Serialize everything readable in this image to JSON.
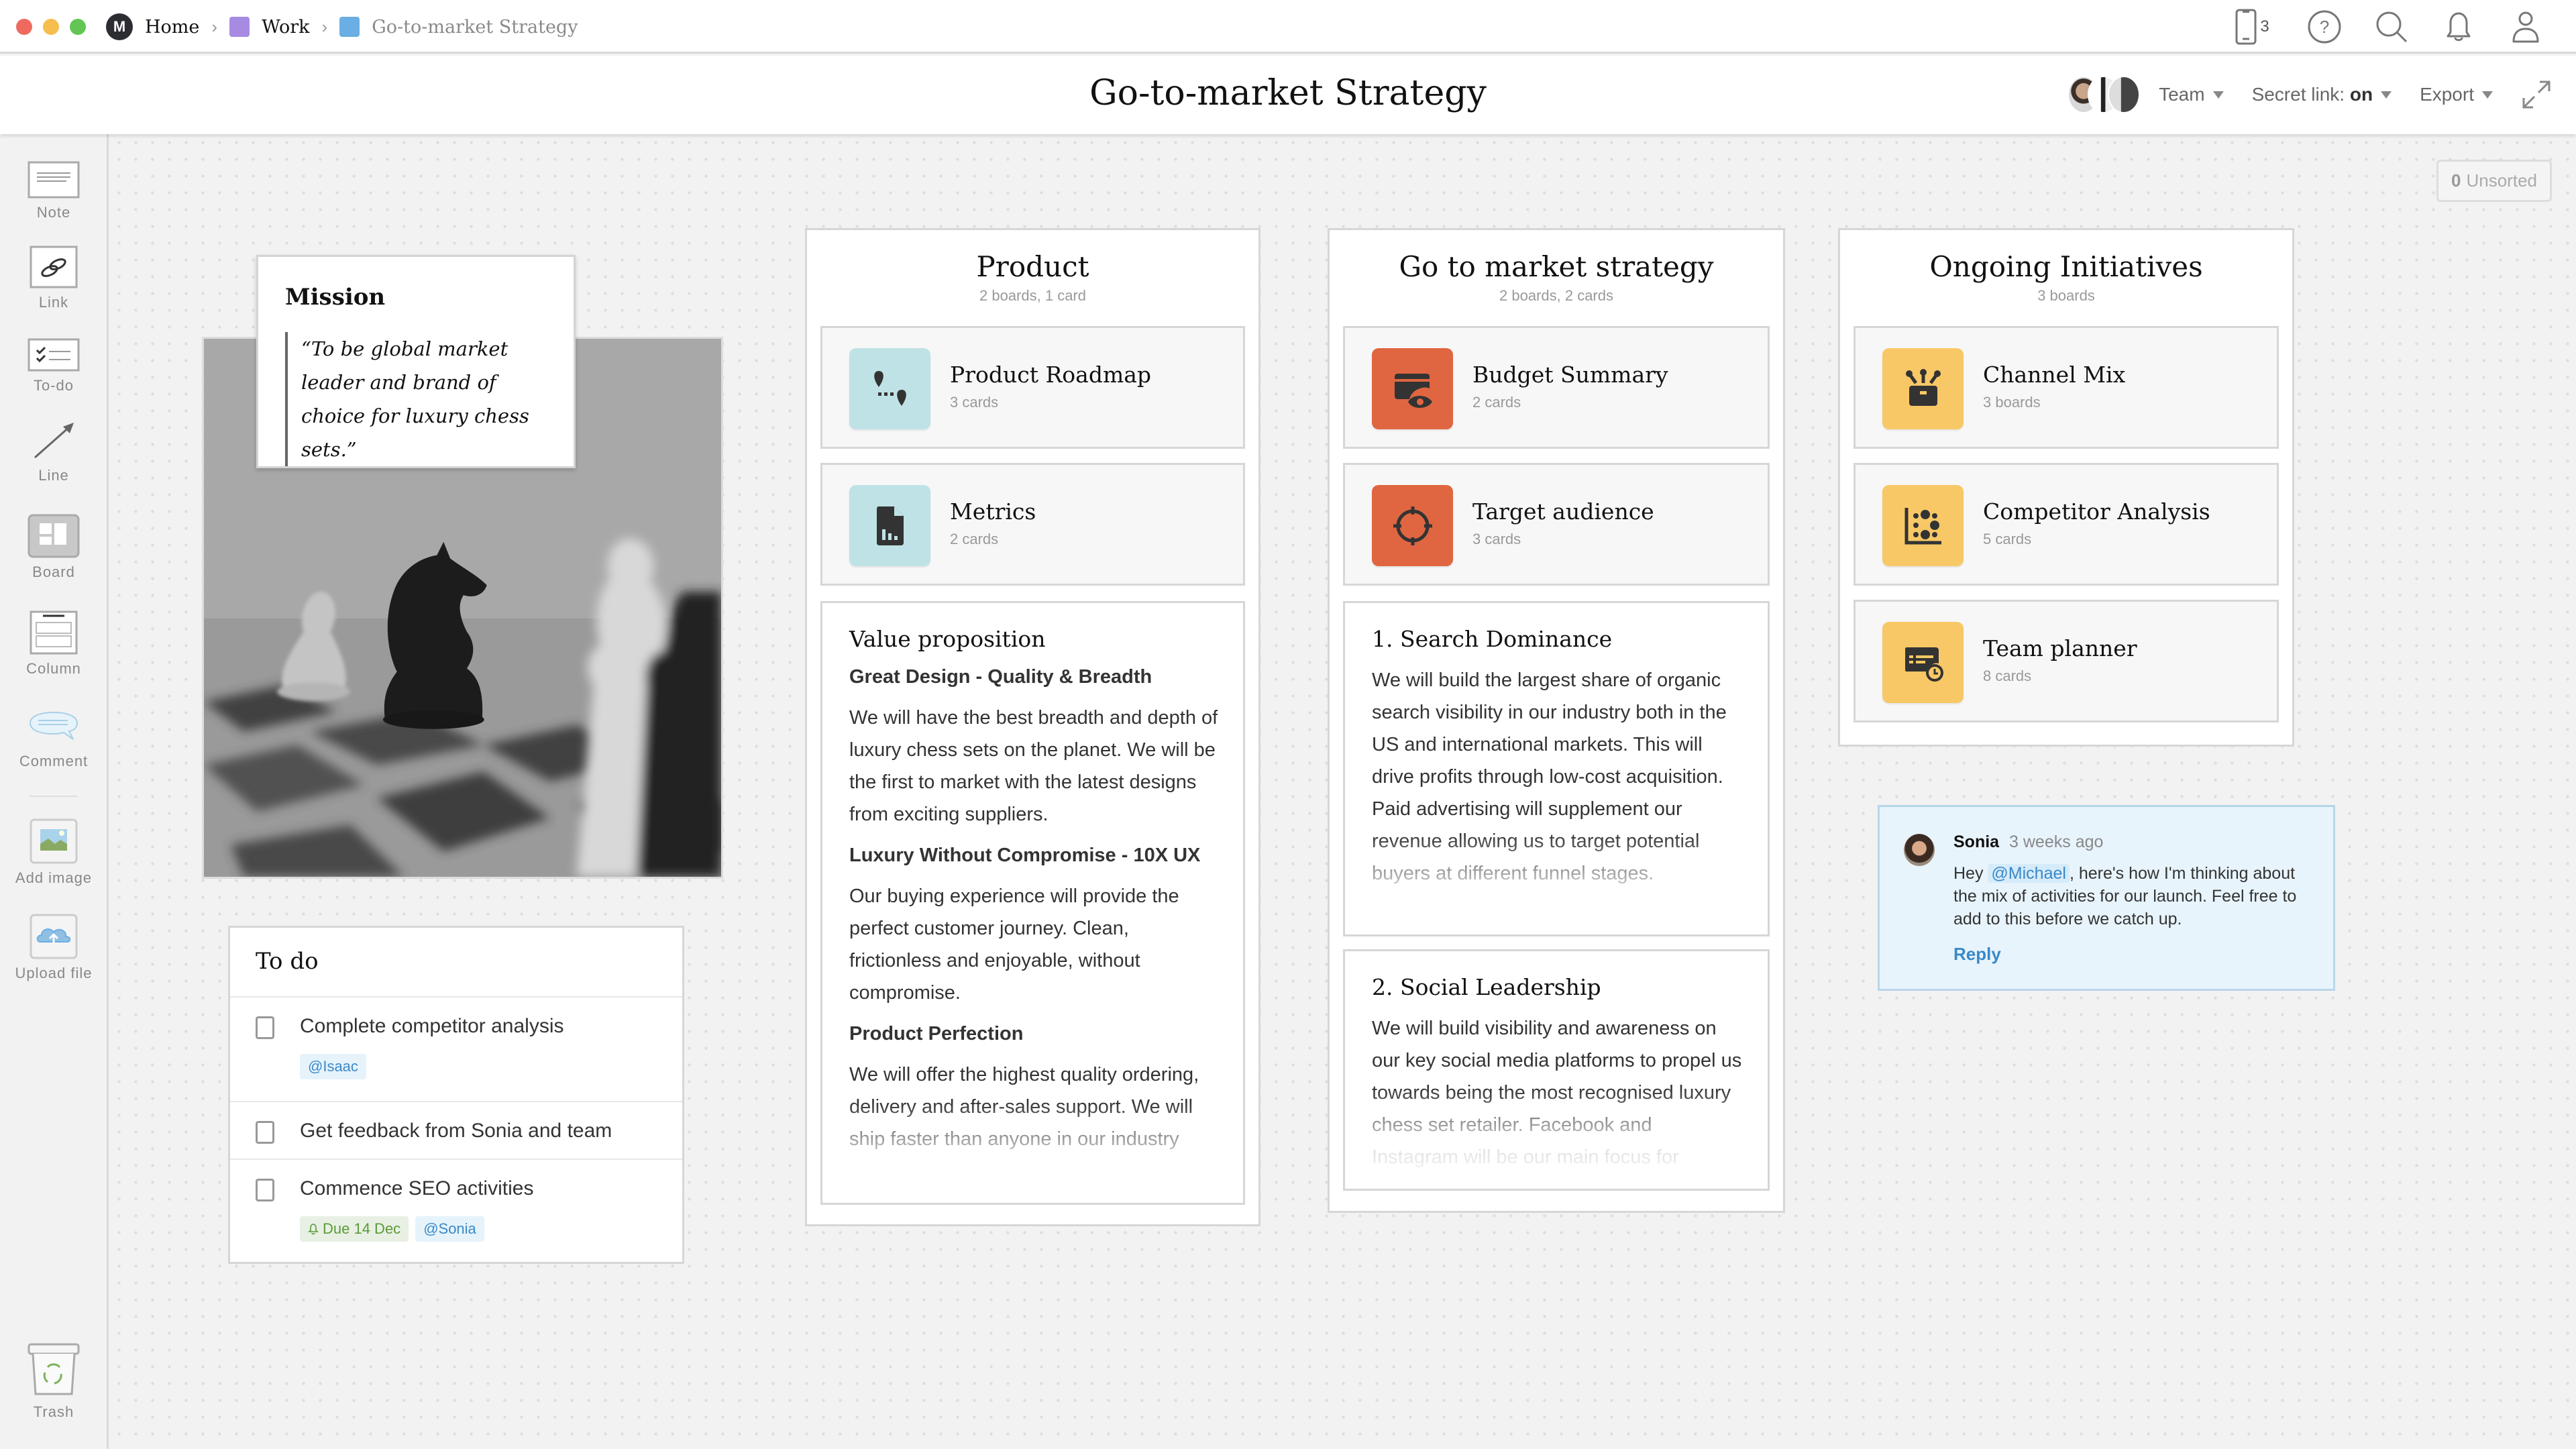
{
  "window": {
    "traffic_lights": {
      "close": "#ee6a5f",
      "minimize": "#f5be4f",
      "maximize": "#62c554"
    }
  },
  "breadcrumb": {
    "items": [
      {
        "label": "Home",
        "icon": "milanote-logo-icon",
        "color": "#2c2c33"
      },
      {
        "label": "Work",
        "icon": "board-square-icon",
        "color": "#a78be3"
      },
      {
        "label": "Go-to-market Strategy",
        "icon": "board-square-icon",
        "color": "#6aaee3"
      }
    ]
  },
  "top_icons": {
    "devices_count": "3",
    "icons": [
      "mobile-device-icon",
      "help-icon",
      "search-icon",
      "bell-icon",
      "user-icon"
    ]
  },
  "header": {
    "title": "Go-to-market Strategy",
    "team_label": "Team",
    "secret_link_label": "Secret link:",
    "secret_link_value": "on",
    "export_label": "Export"
  },
  "toolbar": {
    "items": [
      {
        "label": "Note",
        "icon": "note-icon"
      },
      {
        "label": "Link",
        "icon": "link-icon"
      },
      {
        "label": "To-do",
        "icon": "todo-icon"
      },
      {
        "label": "Line",
        "icon": "line-arrow-icon"
      },
      {
        "label": "Board",
        "icon": "board-icon"
      },
      {
        "label": "Column",
        "icon": "column-icon"
      },
      {
        "label": "Comment",
        "icon": "comment-icon"
      },
      {
        "label": "Add image",
        "icon": "image-icon"
      },
      {
        "label": "Upload file",
        "icon": "upload-cloud-icon"
      }
    ],
    "trash_label": "Trash"
  },
  "unsorted": {
    "count": "0",
    "label": "Unsorted"
  },
  "mission": {
    "title": "Mission",
    "quote": "“To be global market leader and brand of choice for luxury chess sets.”"
  },
  "todo": {
    "title": "To do",
    "items": [
      {
        "text": "Complete competitor analysis",
        "checked": false,
        "tags": [
          {
            "type": "user",
            "label": "@Isaac"
          }
        ]
      },
      {
        "text": "Get feedback from Sonia and team",
        "checked": false,
        "tags": []
      },
      {
        "text": "Commence SEO activities",
        "checked": false,
        "tags": [
          {
            "type": "due",
            "label": "Due 14 Dec"
          },
          {
            "type": "user",
            "label": "@Sonia"
          }
        ]
      }
    ]
  },
  "columns": {
    "product": {
      "title": "Product",
      "subtitle": "2 boards, 1 card",
      "boards": [
        {
          "name": "Product Roadmap",
          "count": "3 cards",
          "icon": "roadmap-pins-icon",
          "color": "#bfe2e6"
        },
        {
          "name": "Metrics",
          "count": "2 cards",
          "icon": "chart-document-icon",
          "color": "#bfe2e6"
        }
      ],
      "note": {
        "title": "Value proposition",
        "sections": [
          {
            "heading": "Great Design - Quality & Breadth",
            "text": "We will have the best breadth and depth of luxury chess sets on the planet. We will be the first to market with the latest designs from exciting suppliers."
          },
          {
            "heading": "Luxury Without Compromise - 10X UX",
            "text": "Our buying experience will provide the perfect customer journey. Clean, frictionless and enjoyable, without compromise."
          },
          {
            "heading": "Product Perfection",
            "text": "We will offer the highest quality ordering, delivery and after-sales support. We will ship faster than anyone in our industry"
          }
        ]
      }
    },
    "gtm": {
      "title": "Go to market strategy",
      "subtitle": "2 boards, 2 cards",
      "boards": [
        {
          "name": "Budget Summary",
          "count": "2 cards",
          "icon": "budget-eye-icon",
          "color": "#e06641"
        },
        {
          "name": "Target audience",
          "count": "3 cards",
          "icon": "target-crosshair-icon",
          "color": "#e06641"
        }
      ],
      "notes": [
        {
          "title": "1. Search Dominance",
          "text": "We will build the largest share of organic search visibility in our industry both in the US and international markets. This will drive profits through low-cost acquisition. Paid advertising will supplement our revenue allowing us to target potential buyers at different funnel stages."
        },
        {
          "title": "2. Social Leadership",
          "text": "We will build visibility and awareness on our key social media platforms to propel us towards being the most recognised luxury chess set retailer. Facebook and Instagram will be our main focus for"
        }
      ]
    },
    "ongoing": {
      "title": "Ongoing Initiatives",
      "subtitle": "3 boards",
      "boards": [
        {
          "name": "Channel Mix",
          "count": "3 boards",
          "icon": "channel-mix-icon",
          "color": "#f8c866"
        },
        {
          "name": "Competitor Analysis",
          "count": "5 cards",
          "icon": "scatter-chart-icon",
          "color": "#f8c866"
        },
        {
          "name": "Team planner",
          "count": "8 cards",
          "icon": "calendar-clock-icon",
          "color": "#f8c866"
        }
      ]
    }
  },
  "comment": {
    "author": "Sonia",
    "time": "3 weeks ago",
    "text_before": "Hey ",
    "mention": "@Michael",
    "text_after": ", here's how I'm thinking about the mix of activities for our launch. Feel free to add to this before we catch up.",
    "reply_label": "Reply"
  }
}
